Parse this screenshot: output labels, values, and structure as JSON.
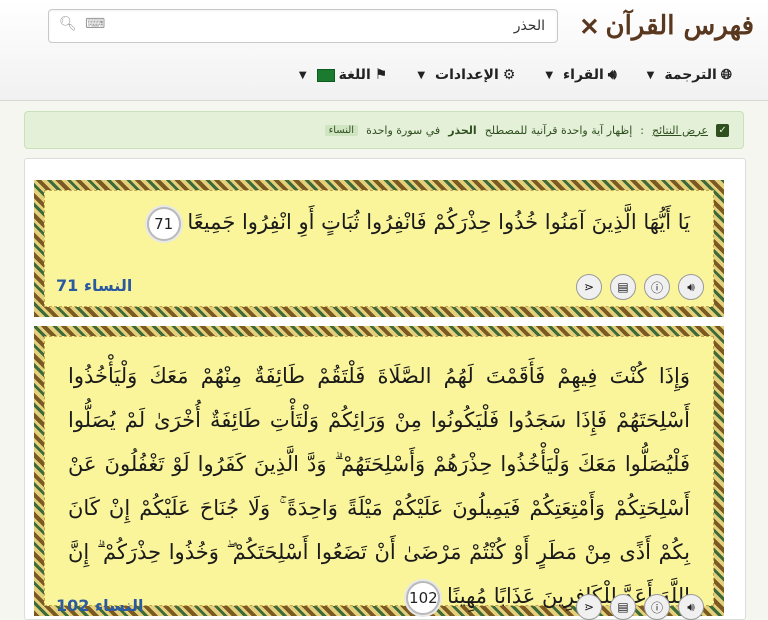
{
  "brand": {
    "title": "فهرس القرآن"
  },
  "search": {
    "value": "الحذر",
    "placeholder": ""
  },
  "menu": {
    "translation": "الترجمة",
    "reciter": "القراء",
    "settings": "الإعدادات",
    "language": "اللغة"
  },
  "notice": {
    "show_results": "عرض النتائج",
    "sep": ":",
    "phrase": "إظهار آية واحدة قرآنية للمصطلح",
    "term": "الحذر",
    "phrase2": "في سورة واحدة",
    "surah_tag": "النساء"
  },
  "verses": [
    {
      "text": "يَا أَيُّهَا الَّذِينَ آمَنُوا خُذُوا حِذْرَكُمْ فَانْفِرُوا ثُبَاتٍ أَوِ انْفِرُوا جَمِيعًا",
      "number": "71",
      "ref": "النساء 71"
    },
    {
      "text": "وَإِذَا كُنْتَ فِيهِمْ فَأَقَمْتَ لَهُمُ الصَّلَاةَ فَلْتَقُمْ طَائِفَةٌ مِنْهُمْ مَعَكَ وَلْيَأْخُذُوا أَسْلِحَتَهُمْ فَإِذَا سَجَدُوا فَلْيَكُونُوا مِنْ وَرَائِكُمْ وَلْتَأْتِ طَائِفَةٌ أُخْرَىٰ لَمْ يُصَلُّوا فَلْيُصَلُّوا مَعَكَ وَلْيَأْخُذُوا حِذْرَهُمْ وَأَسْلِحَتَهُمْ ۗ وَدَّ الَّذِينَ كَفَرُوا لَوْ تَغْفُلُونَ عَنْ أَسْلِحَتِكُمْ وَأَمْتِعَتِكُمْ فَيَمِيلُونَ عَلَيْكُمْ مَيْلَةً وَاحِدَةً ۚ وَلَا جُنَاحَ عَلَيْكُمْ إِنْ كَانَ بِكُمْ أَذًى مِنْ مَطَرٍ أَوْ كُنْتُمْ مَرْضَىٰ أَنْ تَضَعُوا أَسْلِحَتَكُمْ ۖ وَخُذُوا حِذْرَكُمْ ۗ إِنَّ اللَّهَ أَعَدَّ لِلْكَافِرِينَ عَذَابًا مُهِينًا",
      "number": "102",
      "ref": "النساء 102"
    }
  ],
  "icons": [
    "search-icon",
    "keyboard-icon",
    "globe-icon",
    "speaker-icon",
    "gear-icon",
    "flag-icon",
    "check-icon",
    "audio-icon",
    "info-icon",
    "pdf-icon",
    "share-icon"
  ]
}
